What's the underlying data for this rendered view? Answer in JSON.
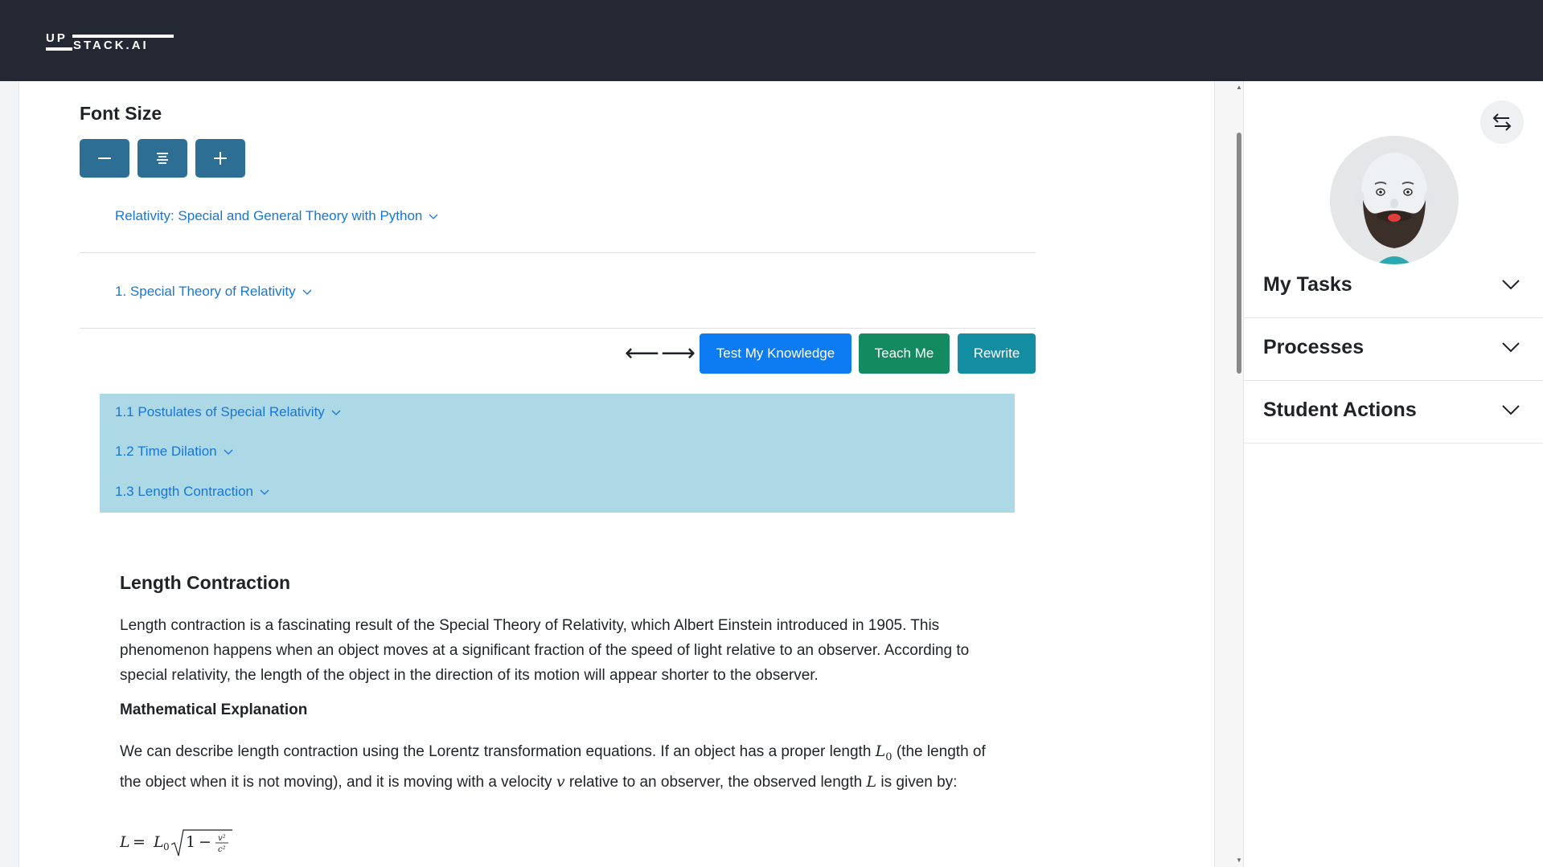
{
  "brand": {
    "logo_up": "UP",
    "logo_stack": "STACK.AI"
  },
  "font_size": {
    "title": "Font Size",
    "buttons": [
      {
        "name": "decrease-font-button",
        "icon": "minus-icon"
      },
      {
        "name": "reset-font-button",
        "icon": "align-center-icon"
      },
      {
        "name": "increase-font-button",
        "icon": "plus-icon"
      }
    ]
  },
  "breadcrumbs": {
    "course": "Relativity: Special and General Theory with Python",
    "chapter": "1. Special Theory of Relativity"
  },
  "nav": {
    "prev_arrow": "⟵",
    "next_arrow": "⟶",
    "test_label": "Test My Knowledge",
    "teach_label": "Teach Me",
    "rewrite_label": "Rewrite"
  },
  "subsections": [
    {
      "label": "1.1 Postulates of Special Relativity"
    },
    {
      "label": "1.2 Time Dilation"
    },
    {
      "label": "1.3 Length Contraction"
    }
  ],
  "article": {
    "heading": "Length Contraction",
    "intro": "Length contraction is a fascinating result of the Special Theory of Relativity, which Albert Einstein introduced in 1905. This phenomenon happens when an object moves at a significant fraction of the speed of light relative to an observer. According to special relativity, the length of the object in the direction of its motion will appear shorter to the observer.",
    "subheading": "Mathematical Explanation",
    "para2_a": "We can describe length contraction using the Lorentz transformation equations. If an object has a proper length ",
    "para2_L0": "L",
    "para2_L0_sub": "0",
    "para2_b": " (the length of the object when it is not moving), and it is moving with a velocity ",
    "para2_v": "v",
    "para2_c": " relative to an observer, the observed length ",
    "para2_L": "L",
    "para2_d": " is given by:"
  },
  "right_panel": {
    "accordions": [
      {
        "label": "My Tasks"
      },
      {
        "label": "Processes"
      },
      {
        "label": "Student Actions"
      }
    ]
  },
  "colors": {
    "topbar": "#232833",
    "font_button": "#2d6f94",
    "test_button": "#0d7bf2",
    "teach_button": "#138a5f",
    "rewrite_button": "#138ea3",
    "subsection_bg": "#add8e6",
    "link": "#1677d6"
  }
}
